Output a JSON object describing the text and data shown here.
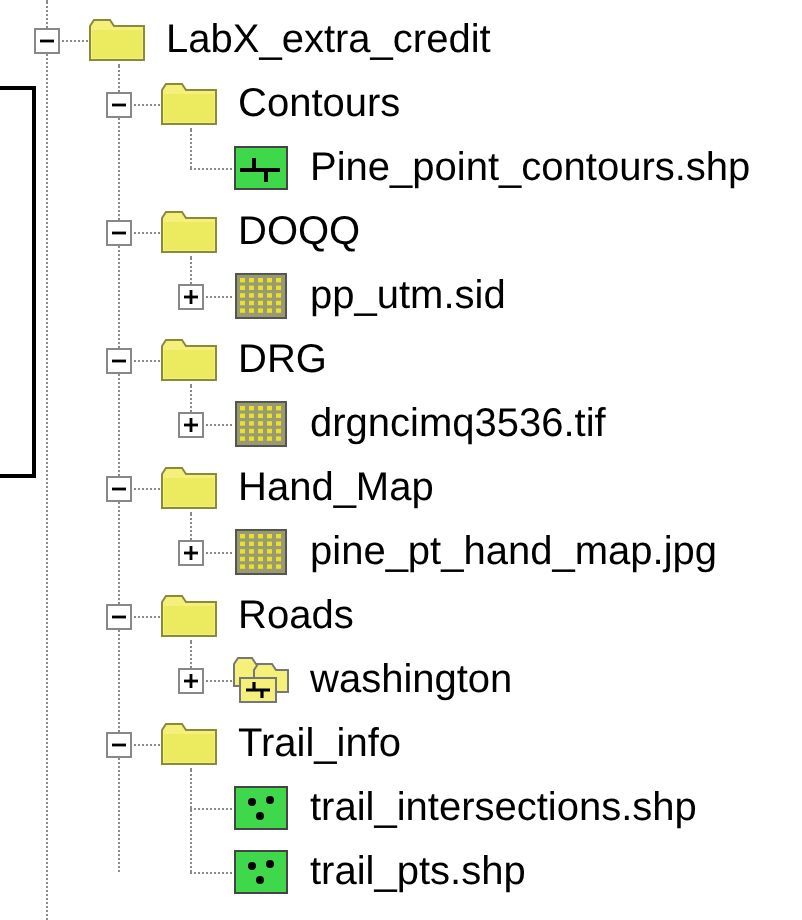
{
  "tree": [
    {
      "label": "LabX_extra_credit",
      "kind": "folder",
      "expanded": true,
      "children": [
        {
          "label": "Contours",
          "kind": "folder",
          "expanded": true,
          "children": [
            {
              "label": "Pine_point_contours.shp",
              "kind": "line-layer"
            }
          ]
        },
        {
          "label": "DOQQ",
          "kind": "folder",
          "expanded": true,
          "children": [
            {
              "label": "pp_utm.sid",
              "kind": "raster",
              "expanded": false
            }
          ]
        },
        {
          "label": "DRG",
          "kind": "folder",
          "expanded": true,
          "children": [
            {
              "label": "drgncimq3536.tif",
              "kind": "raster",
              "expanded": false
            }
          ]
        },
        {
          "label": "Hand_Map",
          "kind": "folder",
          "expanded": true,
          "children": [
            {
              "label": "pine_pt_hand_map.jpg",
              "kind": "raster",
              "expanded": false
            }
          ]
        },
        {
          "label": "Roads",
          "kind": "folder",
          "expanded": true,
          "children": [
            {
              "label": "washington",
              "kind": "group-layer",
              "expanded": false
            }
          ]
        },
        {
          "label": "Trail_info",
          "kind": "folder",
          "expanded": true,
          "children": [
            {
              "label": "trail_intersections.shp",
              "kind": "point-layer"
            },
            {
              "label": "trail_pts.shp",
              "kind": "point-layer"
            }
          ]
        }
      ]
    }
  ]
}
